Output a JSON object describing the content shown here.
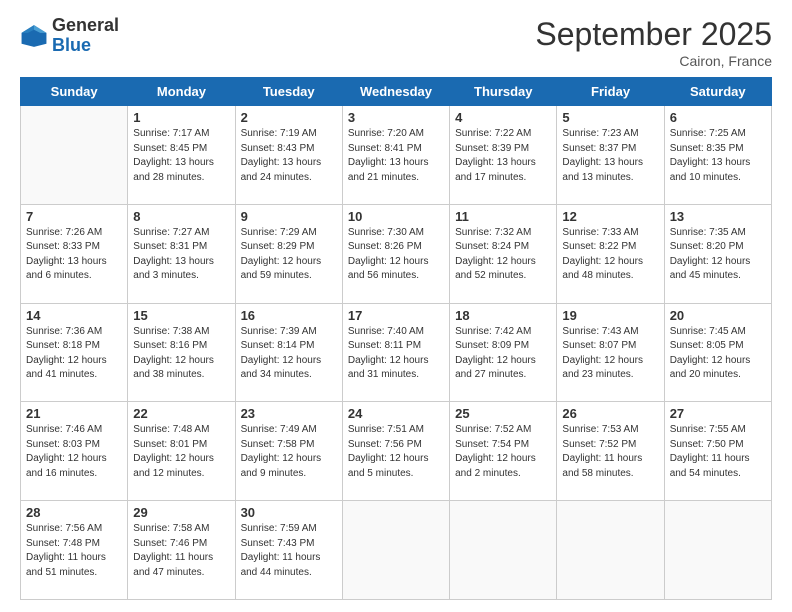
{
  "logo": {
    "general": "General",
    "blue": "Blue"
  },
  "header": {
    "month": "September 2025",
    "location": "Cairon, France"
  },
  "days_of_week": [
    "Sunday",
    "Monday",
    "Tuesday",
    "Wednesday",
    "Thursday",
    "Friday",
    "Saturday"
  ],
  "weeks": [
    [
      {
        "day": "",
        "info": ""
      },
      {
        "day": "1",
        "info": "Sunrise: 7:17 AM\nSunset: 8:45 PM\nDaylight: 13 hours\nand 28 minutes."
      },
      {
        "day": "2",
        "info": "Sunrise: 7:19 AM\nSunset: 8:43 PM\nDaylight: 13 hours\nand 24 minutes."
      },
      {
        "day": "3",
        "info": "Sunrise: 7:20 AM\nSunset: 8:41 PM\nDaylight: 13 hours\nand 21 minutes."
      },
      {
        "day": "4",
        "info": "Sunrise: 7:22 AM\nSunset: 8:39 PM\nDaylight: 13 hours\nand 17 minutes."
      },
      {
        "day": "5",
        "info": "Sunrise: 7:23 AM\nSunset: 8:37 PM\nDaylight: 13 hours\nand 13 minutes."
      },
      {
        "day": "6",
        "info": "Sunrise: 7:25 AM\nSunset: 8:35 PM\nDaylight: 13 hours\nand 10 minutes."
      }
    ],
    [
      {
        "day": "7",
        "info": "Sunrise: 7:26 AM\nSunset: 8:33 PM\nDaylight: 13 hours\nand 6 minutes."
      },
      {
        "day": "8",
        "info": "Sunrise: 7:27 AM\nSunset: 8:31 PM\nDaylight: 13 hours\nand 3 minutes."
      },
      {
        "day": "9",
        "info": "Sunrise: 7:29 AM\nSunset: 8:29 PM\nDaylight: 12 hours\nand 59 minutes."
      },
      {
        "day": "10",
        "info": "Sunrise: 7:30 AM\nSunset: 8:26 PM\nDaylight: 12 hours\nand 56 minutes."
      },
      {
        "day": "11",
        "info": "Sunrise: 7:32 AM\nSunset: 8:24 PM\nDaylight: 12 hours\nand 52 minutes."
      },
      {
        "day": "12",
        "info": "Sunrise: 7:33 AM\nSunset: 8:22 PM\nDaylight: 12 hours\nand 48 minutes."
      },
      {
        "day": "13",
        "info": "Sunrise: 7:35 AM\nSunset: 8:20 PM\nDaylight: 12 hours\nand 45 minutes."
      }
    ],
    [
      {
        "day": "14",
        "info": "Sunrise: 7:36 AM\nSunset: 8:18 PM\nDaylight: 12 hours\nand 41 minutes."
      },
      {
        "day": "15",
        "info": "Sunrise: 7:38 AM\nSunset: 8:16 PM\nDaylight: 12 hours\nand 38 minutes."
      },
      {
        "day": "16",
        "info": "Sunrise: 7:39 AM\nSunset: 8:14 PM\nDaylight: 12 hours\nand 34 minutes."
      },
      {
        "day": "17",
        "info": "Sunrise: 7:40 AM\nSunset: 8:11 PM\nDaylight: 12 hours\nand 31 minutes."
      },
      {
        "day": "18",
        "info": "Sunrise: 7:42 AM\nSunset: 8:09 PM\nDaylight: 12 hours\nand 27 minutes."
      },
      {
        "day": "19",
        "info": "Sunrise: 7:43 AM\nSunset: 8:07 PM\nDaylight: 12 hours\nand 23 minutes."
      },
      {
        "day": "20",
        "info": "Sunrise: 7:45 AM\nSunset: 8:05 PM\nDaylight: 12 hours\nand 20 minutes."
      }
    ],
    [
      {
        "day": "21",
        "info": "Sunrise: 7:46 AM\nSunset: 8:03 PM\nDaylight: 12 hours\nand 16 minutes."
      },
      {
        "day": "22",
        "info": "Sunrise: 7:48 AM\nSunset: 8:01 PM\nDaylight: 12 hours\nand 12 minutes."
      },
      {
        "day": "23",
        "info": "Sunrise: 7:49 AM\nSunset: 7:58 PM\nDaylight: 12 hours\nand 9 minutes."
      },
      {
        "day": "24",
        "info": "Sunrise: 7:51 AM\nSunset: 7:56 PM\nDaylight: 12 hours\nand 5 minutes."
      },
      {
        "day": "25",
        "info": "Sunrise: 7:52 AM\nSunset: 7:54 PM\nDaylight: 12 hours\nand 2 minutes."
      },
      {
        "day": "26",
        "info": "Sunrise: 7:53 AM\nSunset: 7:52 PM\nDaylight: 11 hours\nand 58 minutes."
      },
      {
        "day": "27",
        "info": "Sunrise: 7:55 AM\nSunset: 7:50 PM\nDaylight: 11 hours\nand 54 minutes."
      }
    ],
    [
      {
        "day": "28",
        "info": "Sunrise: 7:56 AM\nSunset: 7:48 PM\nDaylight: 11 hours\nand 51 minutes."
      },
      {
        "day": "29",
        "info": "Sunrise: 7:58 AM\nSunset: 7:46 PM\nDaylight: 11 hours\nand 47 minutes."
      },
      {
        "day": "30",
        "info": "Sunrise: 7:59 AM\nSunset: 7:43 PM\nDaylight: 11 hours\nand 44 minutes."
      },
      {
        "day": "",
        "info": ""
      },
      {
        "day": "",
        "info": ""
      },
      {
        "day": "",
        "info": ""
      },
      {
        "day": "",
        "info": ""
      }
    ]
  ]
}
